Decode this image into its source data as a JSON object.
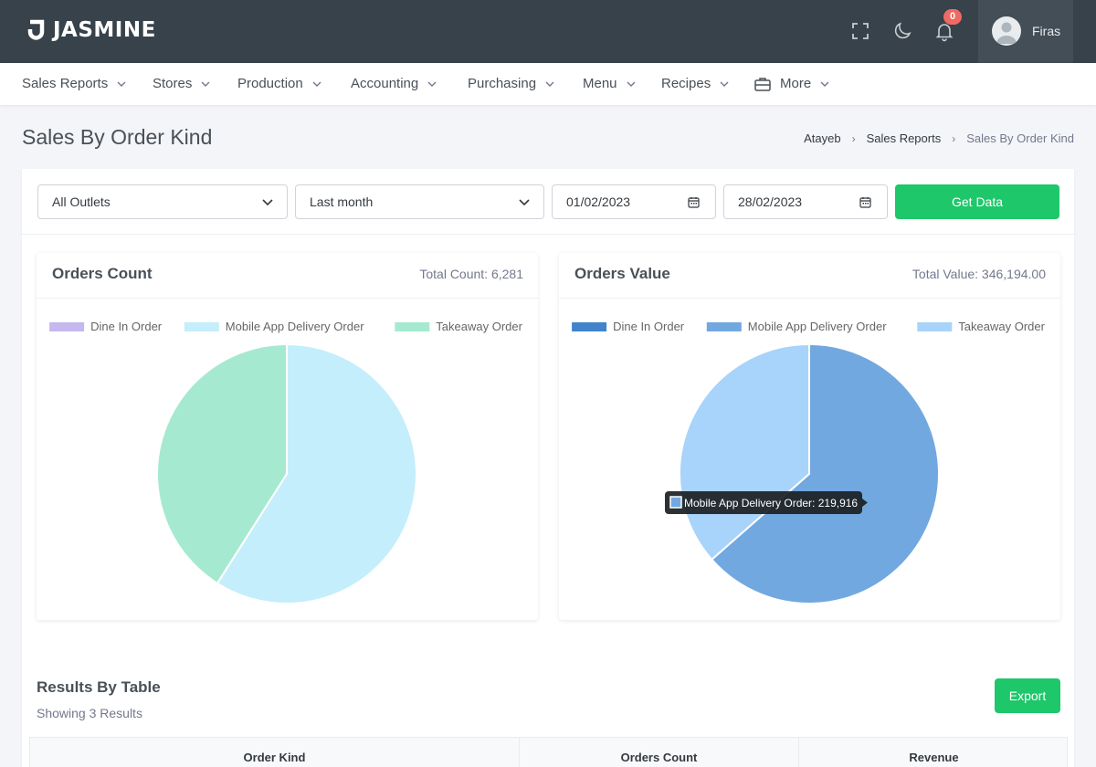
{
  "app": {
    "logo_text": "JASMINE",
    "notification_count": "0",
    "user_name": "Firas"
  },
  "topbar_icons": [
    "fullscreen-icon",
    "moon-icon",
    "bell-icon"
  ],
  "nav": {
    "items": [
      {
        "label": "Sales Reports"
      },
      {
        "label": "Stores"
      },
      {
        "label": "Production"
      },
      {
        "label": "Accounting"
      },
      {
        "label": "Purchasing"
      },
      {
        "label": "Menu"
      },
      {
        "label": "Recipes"
      },
      {
        "label": "More",
        "icon": "briefcase-icon"
      }
    ]
  },
  "page": {
    "title": "Sales By Order Kind",
    "breadcrumb": [
      "Atayeb",
      "Sales Reports",
      "Sales By Order Kind"
    ]
  },
  "filters": {
    "outlet": "All Outlets",
    "period": "Last month",
    "date_from": "01/02/2023",
    "date_to": "28/02/2023",
    "submit_label": "Get Data"
  },
  "charts": {
    "count": {
      "title": "Orders Count",
      "total": "Total Count: 6,281"
    },
    "value": {
      "title": "Orders Value",
      "total": "Total Value: 346,194.00",
      "tooltip": "Mobile App Delivery Order: 219,916"
    }
  },
  "chart_data": [
    {
      "type": "pie",
      "title": "Orders Count",
      "labels": [
        "Dine In Order",
        "Mobile App Delivery Order",
        "Takeaway Order"
      ],
      "values": [
        0,
        3706,
        2575
      ],
      "colors": [
        "#c4b8ee",
        "#c4eefb",
        "#a5ead0"
      ],
      "legend": "top"
    },
    {
      "type": "pie",
      "title": "Orders Value",
      "labels": [
        "Dine In Order",
        "Mobile App Delivery Order",
        "Takeaway Order"
      ],
      "values": [
        0,
        219916,
        126278
      ],
      "colors": [
        "#4184cc",
        "#72a8e0",
        "#a8d3fa"
      ],
      "legend": "top"
    }
  ],
  "results": {
    "title": "Results By Table",
    "subtitle": "Showing 3 Results",
    "export_label": "Export",
    "columns": [
      "Order Kind",
      "Orders Count",
      "Revenue"
    ]
  }
}
